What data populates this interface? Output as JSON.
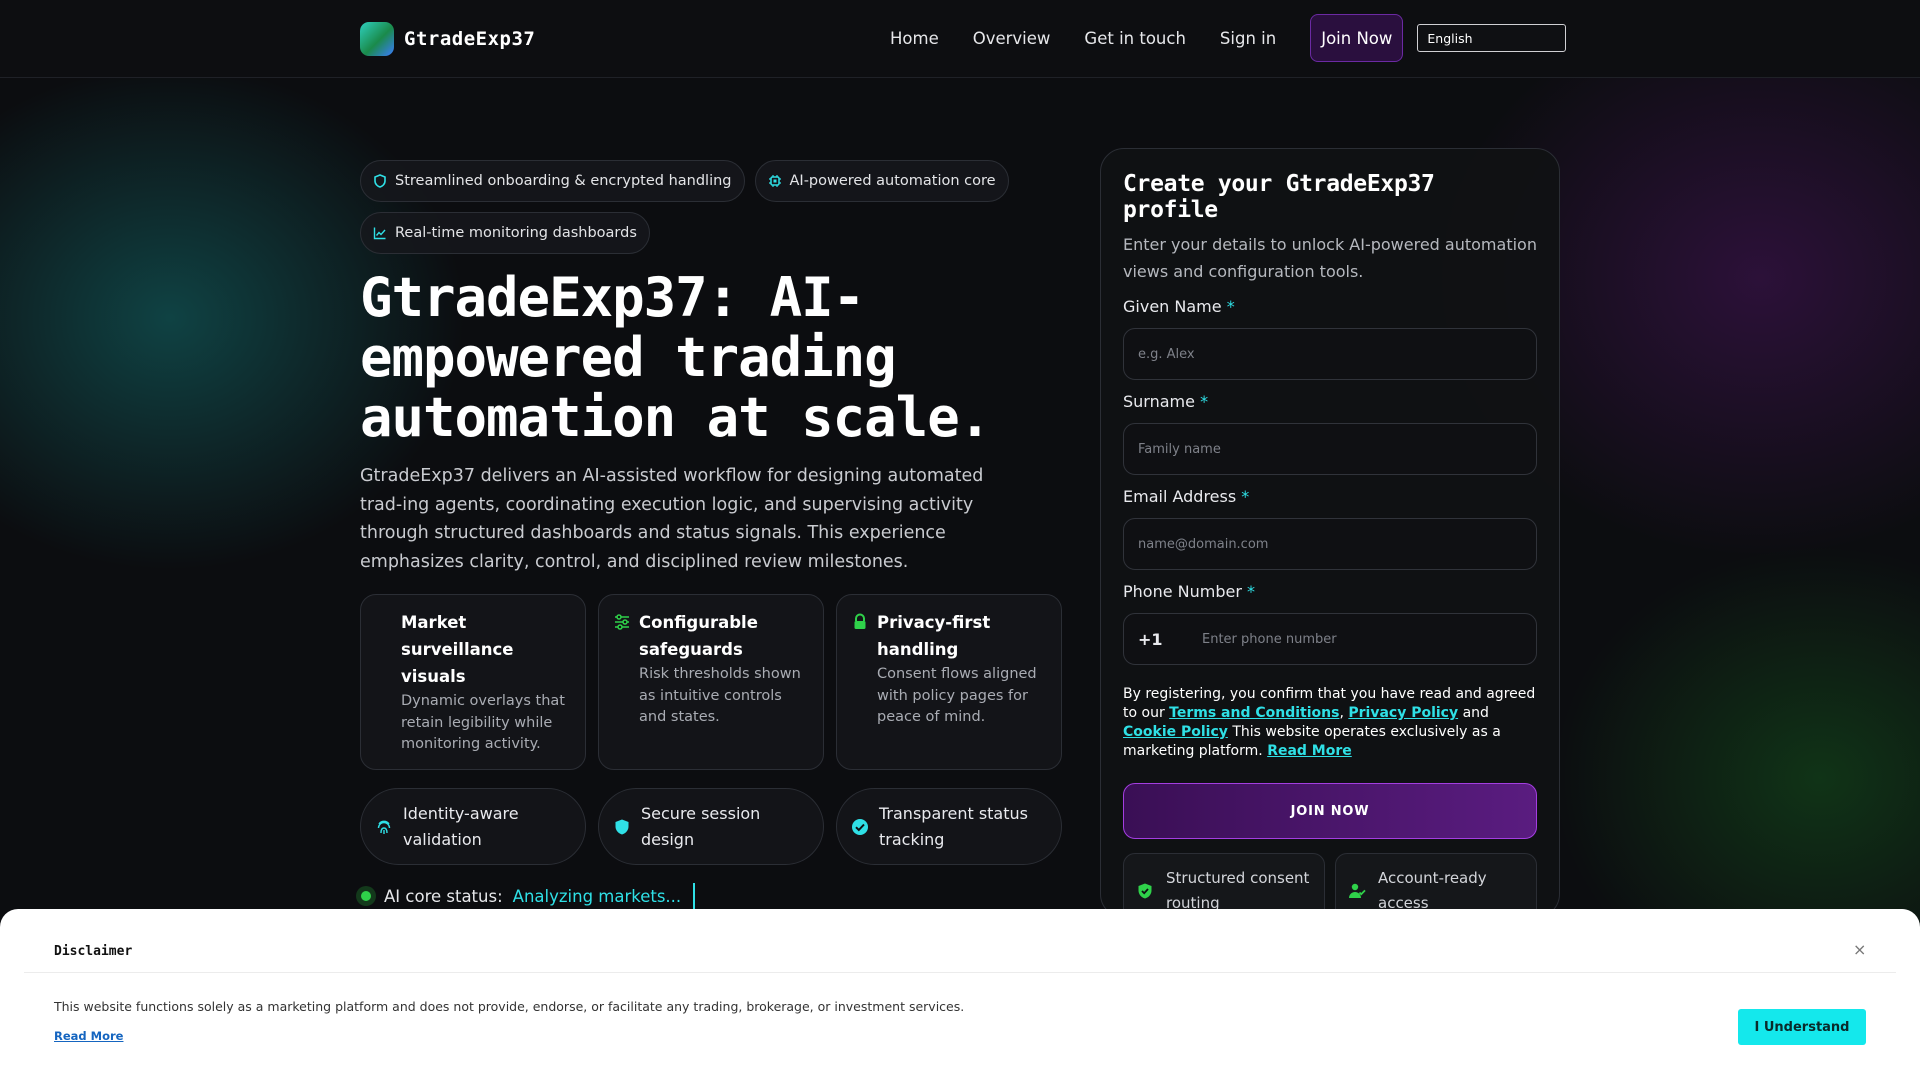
{
  "brand": {
    "name": "GtradeExp37"
  },
  "nav": {
    "links": [
      "Home",
      "Overview",
      "Get in touch",
      "Sign in"
    ],
    "join": "Join Now",
    "language": "English"
  },
  "hero": {
    "pills": [
      {
        "icon": "shield-icon",
        "label": "Streamlined onboarding & encrypted handling"
      },
      {
        "icon": "chip-icon",
        "label": "AI-powered automation core"
      },
      {
        "icon": "chart-line-icon",
        "label": "Real-time monitoring dashboards"
      }
    ],
    "title": "GtradeExp37: AI-empowered trading automation at scale.",
    "description": "GtradeExp37 delivers an AI-assisted workflow for designing automated trad-ing agents, coordinating execution logic, and supervising activity through structured dashboards and status signals. This experience emphasizes clarity, control, and disciplined review milestones.",
    "cards": [
      {
        "title": "Market surveillance visuals",
        "text": "Dynamic overlays that retain legibility while monitoring activity."
      },
      {
        "title": "Configurable safeguards",
        "text": "Risk thresholds shown as intuitive controls and states."
      },
      {
        "title": "Privacy-first handling",
        "text": "Consent flows aligned with policy pages for peace of mind."
      }
    ],
    "features": [
      "Identity-aware validation",
      "Secure session design",
      "Transparent status tracking"
    ],
    "status_label": "AI core status:",
    "status_value": "Analyzing markets..."
  },
  "form": {
    "title": "Create your GtradeExp37 profile",
    "subtitle": "Enter your details to unlock AI-powered automation views and configuration tools.",
    "required_mark": "*",
    "given_name": {
      "label": "Given Name",
      "placeholder": "e.g. Alex"
    },
    "surname": {
      "label": "Surname",
      "placeholder": "Family name"
    },
    "email": {
      "label": "Email Address",
      "placeholder": "name@domain.com"
    },
    "phone": {
      "label": "Phone Number",
      "code": "+1",
      "placeholder": "Enter phone number"
    },
    "consent": {
      "prefix": "By registering, you confirm that you have read and agreed to our",
      "terms": "Terms and Conditions",
      "sep1": ",",
      "privacy": "Privacy Policy",
      "and": "and",
      "cookie": "Cookie Policy",
      "suffix": "This website operates exclusively as a marketing platform.",
      "read_more": "Read More"
    },
    "submit": "JOIN NOW",
    "badges": [
      "Structured consent routing",
      "Account-ready access"
    ]
  },
  "disclaimer": {
    "title": "Disclaimer",
    "close": "×",
    "text": "This website functions solely as a marketing platform and does not provide, endorse, or facilitate any trading, brokerage, or investment services.",
    "read_more": "Read More",
    "button": "I Understand"
  },
  "colors": {
    "accent": "#2fe0e6",
    "purple": "#5a1c80",
    "green": "#2fd24a"
  }
}
